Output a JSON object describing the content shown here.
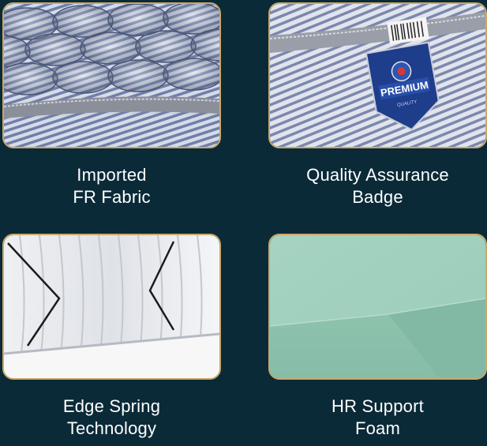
{
  "features": [
    {
      "line1": "Imported",
      "line2": "FR Fabric",
      "image": "quilted-fabric"
    },
    {
      "line1": "Quality Assurance",
      "line2": "Badge",
      "image": "premium-badge"
    },
    {
      "line1": "Edge Spring",
      "line2": "Technology",
      "image": "edge-spring"
    },
    {
      "line1": "HR Support",
      "line2": "Foam",
      "image": "foam-block"
    }
  ],
  "badge": {
    "text": "PREMIUM",
    "subtext": "QUALITY"
  },
  "colors": {
    "background": "#0b2a38",
    "border": "#c9a86a",
    "caption": "#ffffff",
    "foam": "#9fcdbb",
    "fabric_stripe": "#6f7fa8"
  }
}
